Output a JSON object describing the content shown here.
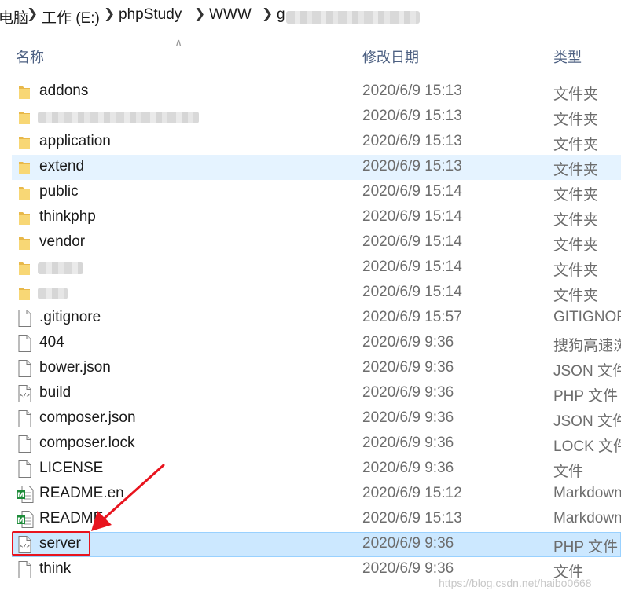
{
  "breadcrumb": {
    "items": [
      "电脑",
      "工作 (E:)",
      "phpStudy",
      "WWW",
      "g"
    ]
  },
  "columns": {
    "name": "名称",
    "date": "修改日期",
    "type": "类型"
  },
  "rows": [
    {
      "name": "addons",
      "date": "2020/6/9 15:13",
      "type": "文件夹",
      "kind": "folder"
    },
    {
      "name": "",
      "date": "2020/6/9 15:13",
      "type": "文件夹",
      "kind": "folder"
    },
    {
      "name": "application",
      "date": "2020/6/9 15:13",
      "type": "文件夹",
      "kind": "folder"
    },
    {
      "name": "extend",
      "date": "2020/6/9 15:13",
      "type": "文件夹",
      "kind": "folder"
    },
    {
      "name": "public",
      "date": "2020/6/9 15:14",
      "type": "文件夹",
      "kind": "folder"
    },
    {
      "name": "thinkphp",
      "date": "2020/6/9 15:14",
      "type": "文件夹",
      "kind": "folder"
    },
    {
      "name": "vendor",
      "date": "2020/6/9 15:14",
      "type": "文件夹",
      "kind": "folder"
    },
    {
      "name": "",
      "date": "2020/6/9 15:14",
      "type": "文件夹",
      "kind": "folder"
    },
    {
      "name": "",
      "date": "2020/6/9 15:14",
      "type": "文件夹",
      "kind": "folder"
    },
    {
      "name": ".gitignore",
      "date": "2020/6/9 15:57",
      "type": "GITIGNORE",
      "kind": "file"
    },
    {
      "name": "404",
      "date": "2020/6/9 9:36",
      "type": "搜狗高速浏",
      "kind": "file"
    },
    {
      "name": "bower.json",
      "date": "2020/6/9 9:36",
      "type": "JSON 文件",
      "kind": "file"
    },
    {
      "name": "build",
      "date": "2020/6/9 9:36",
      "type": "PHP 文件",
      "kind": "php"
    },
    {
      "name": "composer.json",
      "date": "2020/6/9 9:36",
      "type": "JSON 文件",
      "kind": "file"
    },
    {
      "name": "composer.lock",
      "date": "2020/6/9 9:36",
      "type": "LOCK 文件",
      "kind": "file"
    },
    {
      "name": "LICENSE",
      "date": "2020/6/9 9:36",
      "type": "文件",
      "kind": "file"
    },
    {
      "name": "README.en",
      "date": "2020/6/9 15:12",
      "type": "Markdown",
      "kind": "markdown"
    },
    {
      "name": "README",
      "date": "2020/6/9 15:13",
      "type": "Markdown",
      "kind": "markdown"
    },
    {
      "name": "server",
      "date": "2020/6/9 9:36",
      "type": "PHP 文件",
      "kind": "php"
    },
    {
      "name": "think",
      "date": "2020/6/9 9:36",
      "type": "文件",
      "kind": "file"
    }
  ],
  "watermark": "https://blog.csdn.net/haibo0668",
  "colors": {
    "selected_bg": "#cce8ff",
    "hover_bg": "#e5f3ff",
    "folder": "#f8d775",
    "annotation_red": "#e8141e"
  },
  "icons": {
    "folder": "folder-icon",
    "file": "file-icon",
    "php": "php-file-icon",
    "markdown": "markdown-file-icon"
  }
}
